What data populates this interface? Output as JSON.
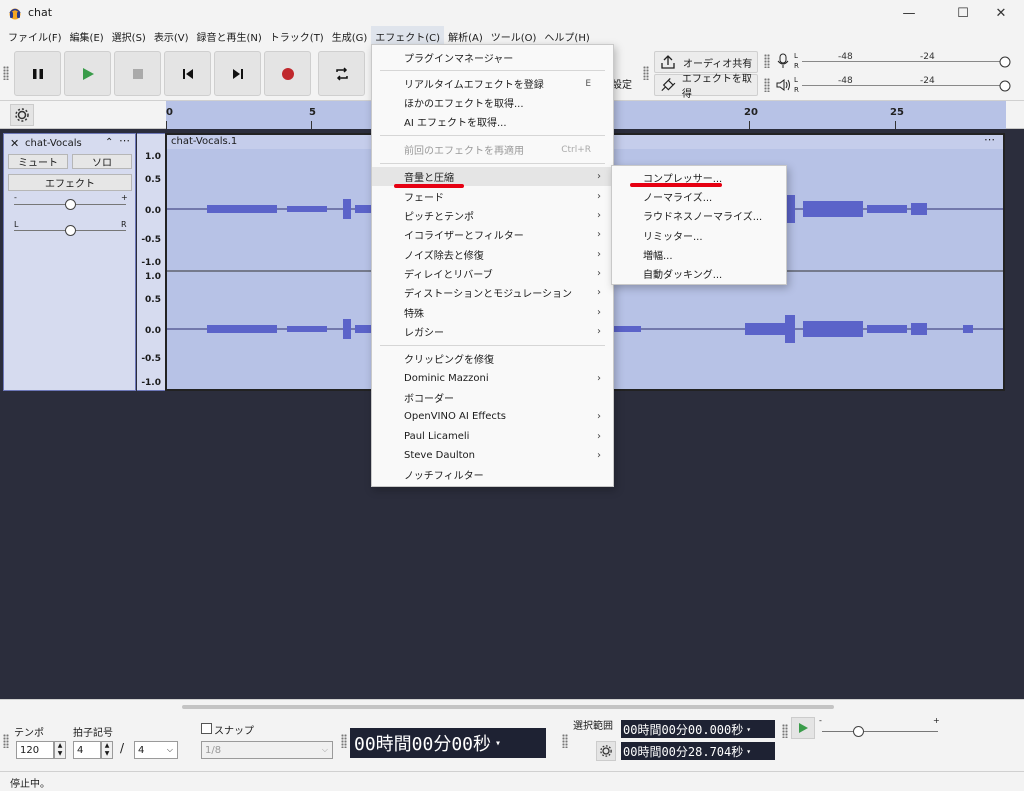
{
  "window": {
    "title": "chat",
    "min": "—",
    "max": "☐",
    "close": "✕"
  },
  "menubar": [
    "ファイル(F)",
    "編集(E)",
    "選択(S)",
    "表示(V)",
    "録音と再生(N)",
    "トラック(T)",
    "生成(G)",
    "エフェクト(C)",
    "解析(A)",
    "ツール(O)",
    "ヘルプ(H)"
  ],
  "toolbar": {
    "settings_label": "設定",
    "share_audio": "オーディオ共有",
    "get_effects": "エフェクトを取得",
    "meter_scale": [
      "-48",
      "-24"
    ],
    "meter_l": "L",
    "meter_r": "R"
  },
  "ruler": {
    "ticks": [
      "0",
      "5",
      "20",
      "25"
    ]
  },
  "track": {
    "name": "chat-Vocals",
    "mute": "ミュート",
    "solo": "ソロ",
    "effects": "エフェクト",
    "pan_left": "L",
    "pan_right": "R",
    "gain_minus": "-",
    "gain_plus": "+",
    "clip_name": "chat-Vocals.1",
    "scale": [
      "1.0",
      "0.5",
      "0.0",
      "-0.5",
      "-1.0",
      "1.0",
      "0.5",
      "0.0",
      "-0.5",
      "-1.0"
    ]
  },
  "effect_menu": {
    "items": [
      {
        "label": "プラグインマネージャー"
      },
      {
        "label": "リアルタイムエフェクトを登録",
        "shortcut": "E"
      },
      {
        "label": "ほかのエフェクトを取得..."
      },
      {
        "label": "AI エフェクトを取得..."
      },
      {
        "label": "前回のエフェクトを再適用",
        "shortcut": "Ctrl+R"
      },
      {
        "label": "音量と圧縮"
      },
      {
        "label": "フェード"
      },
      {
        "label": "ピッチとテンポ"
      },
      {
        "label": "イコライザーとフィルター"
      },
      {
        "label": "ノイズ除去と修復"
      },
      {
        "label": "ディレイとリバーブ"
      },
      {
        "label": "ディストーションとモジュレーション"
      },
      {
        "label": "特殊"
      },
      {
        "label": "レガシー"
      },
      {
        "label": "クリッピングを修復"
      },
      {
        "label": "Dominic Mazzoni"
      },
      {
        "label": "ボコーダー"
      },
      {
        "label": "OpenVINO AI Effects"
      },
      {
        "label": "Paul Licameli"
      },
      {
        "label": "Steve Daulton"
      },
      {
        "label": "ノッチフィルター"
      }
    ]
  },
  "submenu": {
    "items": [
      "コンプレッサー...",
      "ノーマライズ...",
      "ラウドネスノーマライズ...",
      "リミッター...",
      "増幅...",
      "自動ダッキング..."
    ]
  },
  "bottom": {
    "tempo_label": "テンポ",
    "tempo_value": "120",
    "timesig_label": "拍子記号",
    "timesig_num": "4",
    "timesig_slash": "/",
    "timesig_den": "4",
    "snap_label": "スナップ",
    "snap_value": "1/8",
    "time_display": "00時間00分00秒",
    "selection_label": "選択範囲",
    "sel_start": "00時間00分00.000秒",
    "sel_end": "00時間00分28.704秒",
    "speed_minus": "-",
    "speed_plus": "+"
  },
  "status": {
    "text": "停止中。"
  },
  "colors": {
    "accent_red": "#e60012",
    "clip_bg": "#b7c2e6",
    "wave": "#5b63c9",
    "track_bg": "#2b2d3c"
  }
}
